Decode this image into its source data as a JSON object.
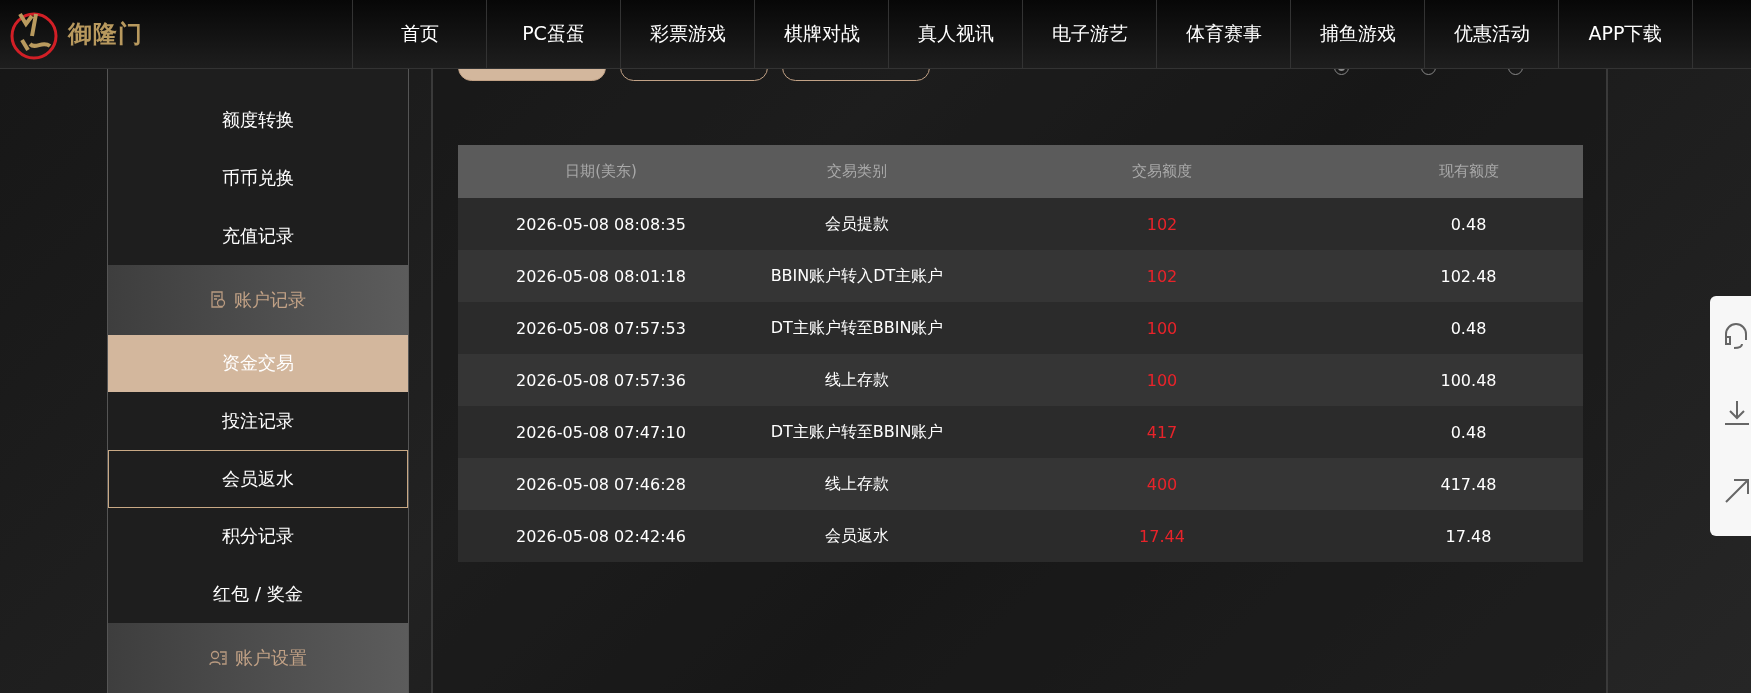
{
  "logo": {
    "text": "御隆门"
  },
  "nav": [
    {
      "label": "首页"
    },
    {
      "label": "PC蛋蛋"
    },
    {
      "label": "彩票游戏"
    },
    {
      "label": "棋牌对战"
    },
    {
      "label": "真人视讯"
    },
    {
      "label": "电子游艺"
    },
    {
      "label": "体育赛事"
    },
    {
      "label": "捕鱼游戏"
    },
    {
      "label": "优惠活动"
    },
    {
      "label": "APP下载"
    }
  ],
  "sidebar": [
    {
      "kind": "item",
      "label": "额度转换",
      "selected": false,
      "outlined": false
    },
    {
      "kind": "item",
      "label": "币币兑换",
      "selected": false,
      "outlined": false
    },
    {
      "kind": "item",
      "label": "充值记录",
      "selected": false,
      "outlined": false
    },
    {
      "kind": "group",
      "label": "账户记录"
    },
    {
      "kind": "item",
      "label": "资金交易",
      "selected": true,
      "outlined": false
    },
    {
      "kind": "item",
      "label": "投注记录",
      "selected": false,
      "outlined": false
    },
    {
      "kind": "item",
      "label": "会员返水",
      "selected": false,
      "outlined": true
    },
    {
      "kind": "item",
      "label": "积分记录",
      "selected": false,
      "outlined": false
    },
    {
      "kind": "item",
      "label": "红包 / 奖金",
      "selected": false,
      "outlined": false
    },
    {
      "kind": "group",
      "label": "账户设置"
    }
  ],
  "filters": [
    {
      "selected": true
    },
    {
      "selected": false
    },
    {
      "selected": false
    }
  ],
  "ranges": [
    {
      "selected": true
    },
    {
      "selected": false
    },
    {
      "selected": false
    }
  ],
  "table": {
    "columns": [
      "日期(美东)",
      "交易类别",
      "交易额度",
      "现有额度"
    ],
    "rows": [
      [
        "2026-05-08 08:08:35",
        "会员提款",
        "102",
        "0.48"
      ],
      [
        "2026-05-08 08:01:18",
        "BBIN账户转入DT主账户",
        "102",
        "102.48"
      ],
      [
        "2026-05-08 07:57:53",
        "DT主账户转至BBIN账户",
        "100",
        "0.48"
      ],
      [
        "2026-05-08 07:57:36",
        "线上存款",
        "100",
        "100.48"
      ],
      [
        "2026-05-08 07:47:10",
        "DT主账户转至BBIN账户",
        "417",
        "0.48"
      ],
      [
        "2026-05-08 07:46:28",
        "线上存款",
        "400",
        "417.48"
      ],
      [
        "2026-05-08 02:42:46",
        "会员返水",
        "17.44",
        "17.48"
      ]
    ]
  }
}
